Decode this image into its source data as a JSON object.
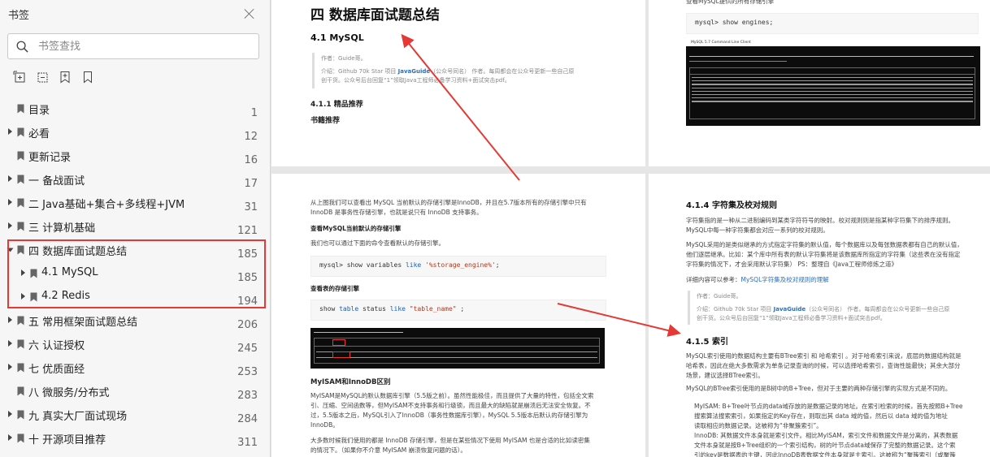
{
  "sidebar": {
    "title": "书签",
    "search_placeholder": "书签查找",
    "tools": [
      "expand-all-icon",
      "collapse-all-icon",
      "add-bookmark-icon",
      "bookmark-icon"
    ],
    "items": [
      {
        "label": "目录",
        "page": "1",
        "level": 0,
        "arrow": false
      },
      {
        "label": "必看",
        "page": "12",
        "level": 0,
        "arrow": true
      },
      {
        "label": "更新记录",
        "page": "16",
        "level": 0,
        "arrow": false
      },
      {
        "label": "一 备战面试",
        "page": "17",
        "level": 0,
        "arrow": true
      },
      {
        "label": "二 Java基础+集合+多线程+JVM",
        "page": "31",
        "level": 0,
        "arrow": true
      },
      {
        "label": "三 计算机基础",
        "page": "121",
        "level": 0,
        "arrow": true
      },
      {
        "label": "四 数据库面试题总结",
        "page": "185",
        "level": 0,
        "arrow": "down"
      },
      {
        "label": "4.1 MySQL",
        "page": "185",
        "level": 1,
        "arrow": true
      },
      {
        "label": "4.2 Redis",
        "page": "194",
        "level": 1,
        "arrow": true
      },
      {
        "label": "五 常用框架面试题总结",
        "page": "206",
        "level": 0,
        "arrow": true
      },
      {
        "label": "六 认证授权",
        "page": "245",
        "level": 0,
        "arrow": true
      },
      {
        "label": "七 优质面经",
        "page": "253",
        "level": 0,
        "arrow": true
      },
      {
        "label": "八 微服务/分布式",
        "page": "283",
        "level": 0,
        "arrow": false
      },
      {
        "label": "九 真实大厂面试现场",
        "page": "284",
        "level": 0,
        "arrow": true
      },
      {
        "label": "十 开源项目推荐",
        "page": "311",
        "level": 0,
        "arrow": true
      }
    ]
  },
  "page1": {
    "title": "四 数据库面试题总结",
    "section": "4.1 MySQL",
    "quote_author": "作者：Guide哥。",
    "quote_line1_pre": "介绍：Github 70k Star 项目 ",
    "quote_link": "JavaGuide",
    "quote_line1_post": "（公众号同名） 作者。每周都会在公众号更新一些自己原",
    "quote_line2": "创干货。公众号后台回复“1”领取Java工程师必备学习资料+面试突击pdf。",
    "sub": "4.1.1 精品推荐",
    "sub2": "书籍推荐"
  },
  "page2": {
    "top_text": "查看MySQL提供的所有存储引擎",
    "code": "mysql> show engines;",
    "term_title": "MySQL 5.7 Command Line Client"
  },
  "page3": {
    "p1_line1": "从上图我们可以查看出 MySQL 当前默认的存储引擎是InnoDB，并且在5.7版本所有的存储引擎中只有",
    "p1_line2": "InnoDB 是事务性存储引擎，也就是说只有 InnoDB 支持事务。",
    "h_default": "查看MySQL当前默认的存储引擎",
    "p2": "我们也可以通过下面的命令查看默认的存储引擎。",
    "code1_pre": "mysql> show variables ",
    "code1_kw": "like",
    "code1_str": " '%storage_engine%'",
    "code1_end": ";",
    "h_table": "查看表的存储引擎",
    "code2_pre": "show ",
    "code2_kw1": "table",
    "code2_mid": " status ",
    "code2_kw2": "like",
    "code2_str": " \"table_name\"",
    "code2_end": " ;",
    "h_myisam": "MyISAM和InnoDB区别",
    "p3_l1": "MyISAM是MySQL的默认数据库引擎（5.5版之前）。虽然性能极佳，而且提供了大量的特性，包括全文索",
    "p3_l2": "引、压缩、空间函数等，但MyISAM不支持事务和行级锁，而且最大的缺陷就是崩溃后无法安全恢复。不",
    "p3_l3": "过，5.5版本之后，MySQL引入了InnoDB（事务性数据库引擎），MySQL 5.5版本后默认的存储引擎为",
    "p3_l4": "InnoDB。",
    "p4_l1": "大多数时候我们使用的都是 InnoDB 存储引擎，但是在某些情况下使用 MyISAM 也是合适的比如读密集",
    "p4_l2": "的情况下。（如果你不介意 MyISAM 崩溃恢复问题的话）。"
  },
  "page4": {
    "h_charset": "4.1.4 字符集及校对规则",
    "c_l1": "字符集指的是一种从二进制编码到某类字符符号的映射。校对规则则是指某种字符集下的排序规则。",
    "c_l2": "MySQL中每一种字符集都会对应一系列的校对规则。",
    "c_l3": "MySQL采用的是类似继承的方式指定字符集的默认值，每个数据库以及每张数据表都有自己的默认值，",
    "c_l4": "他们逐层继承。比如：某个库中所有表的默认字符集将是该数据库所指定的字符集（这些表在没有指定",
    "c_l5": "字符集的情况下，才会采用默认字符集） PS：整理自《Java工程师修炼之道》",
    "detail_pre": "详细内容可以参考：",
    "detail_link": "MySQL字符集及校对规则的理解",
    "q_author": "作者：Guide哥。",
    "q_l1_pre": "介绍：Github 70k Star 项目 ",
    "q_link": "JavaGuide",
    "q_l1_post": "（公众号同名） 作者。每周都会在公众号更新一些自己原",
    "q_l2": "创干货。公众号后台回复“1”领取Java工程师必备学习资料+面试突击pdf。",
    "h_index": "4.1.5 索引",
    "i_l1": "MySQL索引使用的数据结构主要有BTree索引 和 哈希索引 。对于哈希索引来说，底层的数据结构就是",
    "i_l2": "哈希表，因此在绝大多数需求为单条记录查询的时候，可以选择哈希索引，查询性能最快；其余大部分",
    "i_l3": "场景，建议选择BTree索引。",
    "i_l4": "MySQL的BTree索引使用的是B树中的B+Tree，但对于主要的两种存储引擎的实现方式是不同的。",
    "b1_l1": "MyISAM: B+Tree叶节点的data域存放的是数据记录的地址。在索引检索的时候，首先按照B+Tree",
    "b1_l2": "搜索算法搜索索引，如果指定的Key存在，则取出其 data 域的值，然后以 data 域的值为地址",
    "b1_l3": "读取相应的数据记录。这被称为“非聚簇索引”。",
    "b2_l1": "InnoDB: 其数据文件本身就是索引文件。相比MyISAM，索引文件和数据文件是分离的，其表数据",
    "b2_l2": "文件本身就是按B+Tree组织的一个索引结构，树的叶节点data域保存了完整的数据记录。这个索",
    "b2_l3": "引的key是数据表的主键，因此InnoDB表数据文件本身就是主索引。这被称为“聚簇索引（或聚簇"
  }
}
